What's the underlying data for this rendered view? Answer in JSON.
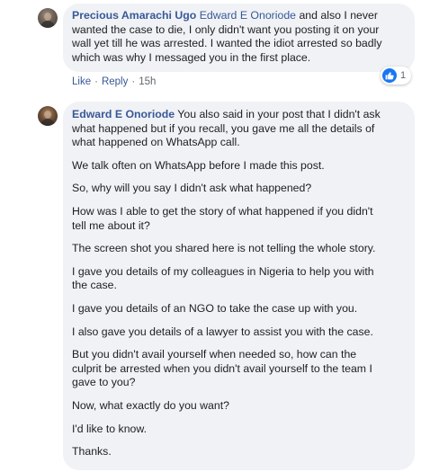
{
  "comments": [
    {
      "author": "Precious Amarachi Ugo",
      "mention": "Edward E Onoriode",
      "text_lines": [
        " and also I never",
        "wanted the case to die, I only didn't want you posting it on your",
        "wall yet till he was arrested. I wanted the idiot arrested so badly",
        "which was why I messaged you in the first place."
      ],
      "actions": {
        "like": "Like",
        "separator": "·",
        "reply": "Reply",
        "time": "15h"
      },
      "reactions": {
        "icon": "thumbs-up-icon",
        "count": "1",
        "color": "#1877f2"
      }
    },
    {
      "author": "Edward E Onoriode",
      "paragraphs": [
        [
          " You also said in your post that I didn't ask",
          "what happened but if you recall, you gave me all the details of",
          "what happened on WhatsApp call."
        ],
        [
          "We talk often on WhatsApp before I made this post."
        ],
        [
          "So, why will you say I didn't ask what happened?"
        ],
        [
          "How was I able to get the story of what happened if you didn't",
          "tell me about it?"
        ],
        [
          "The screen shot you shared here is not telling the whole story."
        ],
        [
          "I gave you details of my colleagues in Nigeria to help you with",
          "the case."
        ],
        [
          "I gave you details of an NGO to take the case up with you."
        ],
        [
          "I also gave you details of a lawyer to assist you with the case."
        ],
        [
          "But you didn't avail yourself when needed so, how can the",
          "culprit be arrested when you didn't avail yourself to the team I",
          "gave to you?"
        ],
        [
          "Now, what exactly do you want?"
        ],
        [
          "I'd like to know."
        ],
        [
          "Thanks."
        ]
      ]
    }
  ],
  "colors": {
    "name_link": "#385898",
    "bubble_bg": "#f0f2f5",
    "meta_text": "#606770"
  }
}
